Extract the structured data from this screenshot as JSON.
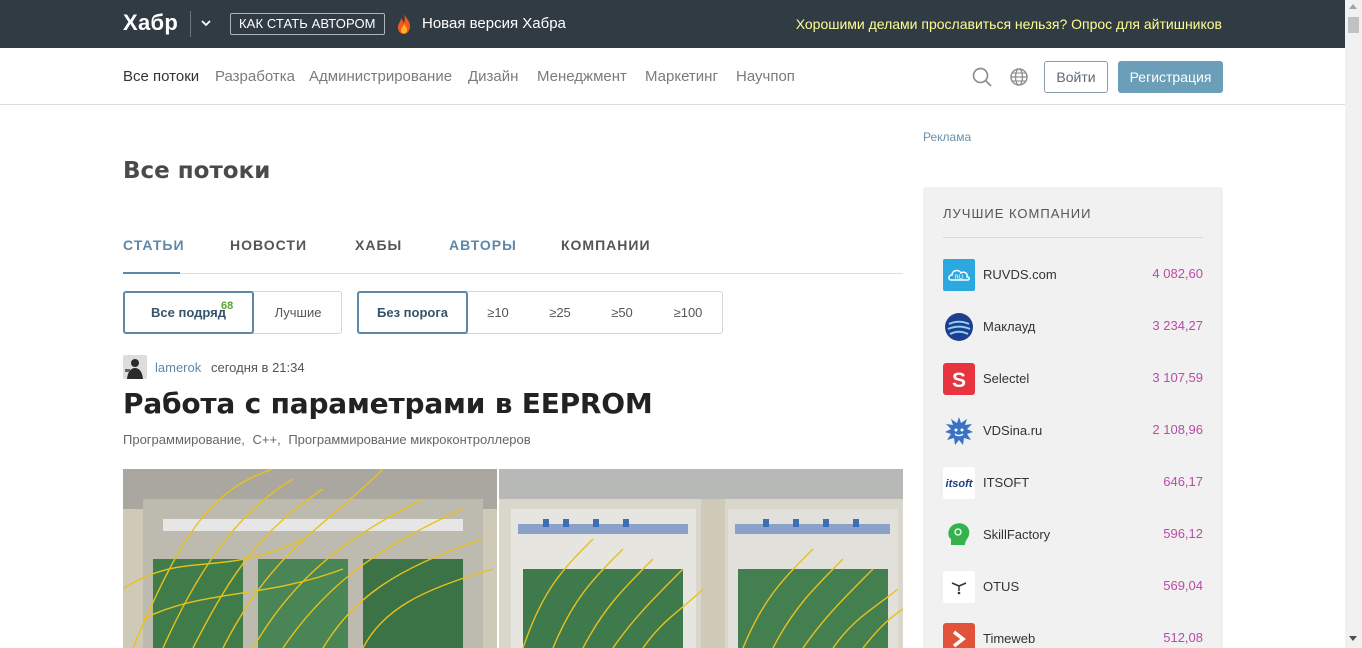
{
  "topbar": {
    "logo": "Хабр",
    "author_button": "КАК СТАТЬ АВТОРОМ",
    "new_version": "Новая версия Хабра",
    "survey": "Хорошими делами прославиться нельзя? Опрос для айтишников"
  },
  "nav": {
    "items": [
      "Все потоки",
      "Разработка",
      "Администрирование",
      "Дизайн",
      "Менеджмент",
      "Маркетинг",
      "Научпоп"
    ],
    "login": "Войти",
    "register": "Регистрация"
  },
  "main": {
    "title": "Все потоки",
    "tabs": [
      "СТАТЬИ",
      "НОВОСТИ",
      "ХАБЫ",
      "АВТОРЫ",
      "КОМПАНИИ"
    ],
    "filters_left": {
      "all": "Все подряд",
      "count": "68",
      "best": "Лучшие"
    },
    "filters_right": [
      "Без порога",
      "≥10",
      "≥25",
      "≥50",
      "≥100"
    ]
  },
  "post": {
    "author": "lamerok",
    "time": "сегодня в 21:34",
    "title": "Работа с параметрами в EEPROM",
    "hubs": [
      "Программирование,",
      "C++,",
      "Программирование микроконтроллеров"
    ]
  },
  "sidebar": {
    "ad_label": "Реклама",
    "companies_title": "ЛУЧШИЕ КОМПАНИИ",
    "companies": [
      {
        "name": "RUVDS.com",
        "rating": "4 082,60",
        "color": "#2ba8e0",
        "icon": "ruvds-logo"
      },
      {
        "name": "Маклауд",
        "rating": "3 234,27",
        "color": "#1e3f8f",
        "icon": "macloud-logo"
      },
      {
        "name": "Selectel",
        "rating": "3 107,59",
        "color": "#e8343e",
        "icon": "selectel-logo"
      },
      {
        "name": "VDSina.ru",
        "rating": "2 108,96",
        "color": "#3a72c4",
        "icon": "vdsina-logo"
      },
      {
        "name": "ITSOFT",
        "rating": "646,17",
        "color": "#ffffff",
        "icon": "itsoft-logo"
      },
      {
        "name": "SkillFactory",
        "rating": "596,12",
        "color": "#35b34a",
        "icon": "skillfactory-logo"
      },
      {
        "name": "OTUS",
        "rating": "569,04",
        "color": "#ffffff",
        "icon": "otus-logo"
      },
      {
        "name": "Timeweb",
        "rating": "512,08",
        "color": "#e0533a",
        "icon": "timeweb-logo"
      }
    ]
  },
  "colors": {
    "topbar": "#303b44",
    "accent": "#5e88a8",
    "rating": "#bb4aa8",
    "survey": "#fffd92",
    "register": "#6b9eb8"
  }
}
